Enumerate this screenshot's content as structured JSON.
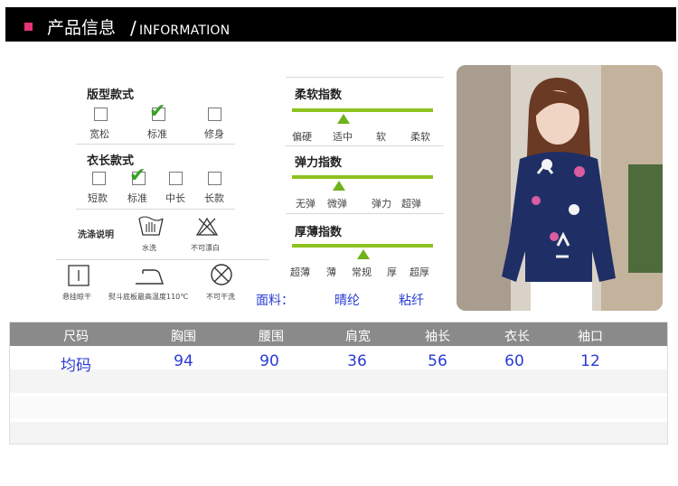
{
  "header": {
    "title": "产品信息",
    "slash": "/",
    "subtitle": "INFORMATION"
  },
  "fit": {
    "title": "版型款式",
    "options": [
      "宽松",
      "标准",
      "修身"
    ],
    "selected": "标准"
  },
  "length": {
    "title": "衣长款式",
    "options": [
      "短款",
      "标准",
      "中长",
      "长款"
    ],
    "selected": "标准"
  },
  "wash": {
    "title": "洗涤说明",
    "icons": [
      {
        "icon": "hand-wash-icon",
        "label": "水洗"
      },
      {
        "icon": "no-bleach-icon",
        "label": "不可漂白"
      }
    ]
  },
  "care": [
    {
      "icon": "hang-dry-icon",
      "label": "悬挂晾干"
    },
    {
      "icon": "iron-icon",
      "label": "熨斗底板最高温度110℃"
    },
    {
      "icon": "no-tumble-dry-icon",
      "label": "不可干洗"
    }
  ],
  "softness": {
    "title": "柔软指数",
    "labels": [
      "偏硬",
      "适中",
      "软",
      "柔软"
    ],
    "selected": "适中"
  },
  "elasticity": {
    "title": "弹力指数",
    "labels": [
      "无弹",
      "微弹",
      "弹力",
      "超弹"
    ],
    "selected": "微弹"
  },
  "thickness": {
    "title": "厚薄指数",
    "labels": [
      "超薄",
      "薄",
      "常规",
      "厚",
      "超厚"
    ],
    "selected": "常规"
  },
  "fabric": {
    "label": "面料：",
    "values": [
      "晴纶",
      "粘纤"
    ]
  },
  "size_table": {
    "headers": [
      "尺码",
      "胸围",
      "腰围",
      "肩宽",
      "袖长",
      "衣长",
      "袖口"
    ],
    "rows": [
      [
        "均码",
        "94",
        "90",
        "36",
        "56",
        "60",
        "12"
      ]
    ]
  },
  "colors": {
    "accent_pink": "#e8337a",
    "index_green": "#8dc21f",
    "value_blue": "#2a3bd6",
    "table_header": "#8a8a8a"
  }
}
